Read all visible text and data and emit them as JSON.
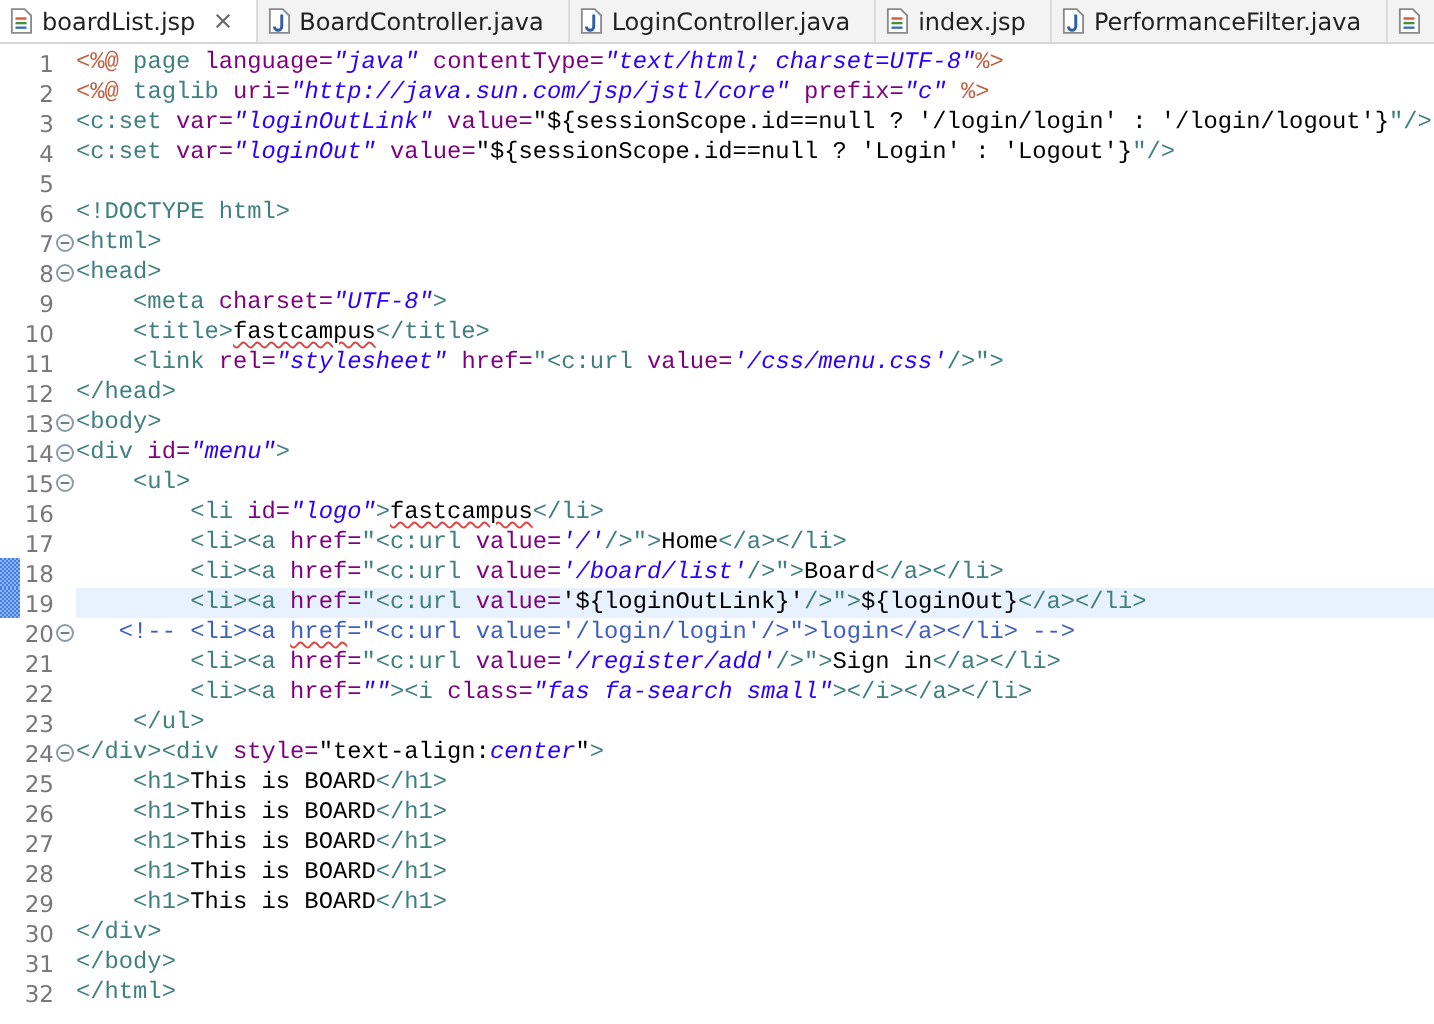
{
  "tabs": [
    {
      "label": "boardList.jsp",
      "kind": "jsp",
      "selected": true
    },
    {
      "label": "BoardController.java",
      "kind": "java",
      "selected": false
    },
    {
      "label": "LoginController.java",
      "kind": "java",
      "selected": false
    },
    {
      "label": "index.jsp",
      "kind": "jsp",
      "selected": false
    },
    {
      "label": "PerformanceFilter.java",
      "kind": "java",
      "selected": false
    },
    {
      "kind": "jsp",
      "selected": false
    }
  ],
  "editor": {
    "lines": [
      {
        "number": "1",
        "fold": false,
        "current": false,
        "marked": false,
        "tokens": [
          {
            "kind": "dir",
            "text": "<%@"
          },
          {
            "kind": "tag",
            "text": " page"
          },
          {
            "kind": "attr",
            "text": " language="
          },
          {
            "kind": "str",
            "text": "\"java\""
          },
          {
            "kind": "attr",
            "text": " contentType="
          },
          {
            "kind": "str",
            "text": "\"text/html; charset=UTF-8\""
          },
          {
            "kind": "dir",
            "text": "%>"
          }
        ]
      },
      {
        "number": "2",
        "fold": false,
        "current": false,
        "marked": false,
        "tokens": [
          {
            "kind": "dir",
            "text": "<%@"
          },
          {
            "kind": "tag",
            "text": " taglib"
          },
          {
            "kind": "attr",
            "text": " uri="
          },
          {
            "kind": "str",
            "text": "\"http://java.sun.com/jsp/jstl/core\""
          },
          {
            "kind": "attr",
            "text": " prefix="
          },
          {
            "kind": "str",
            "text": "\"c\""
          },
          {
            "kind": "dir",
            "text": " %>"
          }
        ]
      },
      {
        "number": "3",
        "fold": false,
        "current": false,
        "marked": false,
        "tokens": [
          {
            "kind": "tag",
            "text": "<c:set"
          },
          {
            "kind": "attr",
            "text": " var="
          },
          {
            "kind": "str",
            "text": "\"loginOutLink\""
          },
          {
            "kind": "attr",
            "text": " value="
          },
          {
            "kind": "text",
            "text": "\"${sessionScope.id==null ? '/login/login' : '/login/logout'}"
          },
          {
            "kind": "tag",
            "text": "\"/>"
          }
        ]
      },
      {
        "number": "4",
        "fold": false,
        "current": false,
        "marked": false,
        "tokens": [
          {
            "kind": "tag",
            "text": "<c:set"
          },
          {
            "kind": "attr",
            "text": " var="
          },
          {
            "kind": "str",
            "text": "\"loginOut\""
          },
          {
            "kind": "attr",
            "text": " value="
          },
          {
            "kind": "text",
            "text": "\"${sessionScope.id==null ? 'Login' : 'Logout'}"
          },
          {
            "kind": "tag",
            "text": "\"/>"
          }
        ]
      },
      {
        "number": "5",
        "fold": false,
        "current": false,
        "marked": false
      },
      {
        "number": "6",
        "fold": false,
        "current": false,
        "marked": false,
        "tokens": [
          {
            "kind": "tag",
            "text": "<!DOCTYPE html>"
          }
        ]
      },
      {
        "number": "7",
        "fold": true,
        "current": false,
        "marked": false,
        "tokens": [
          {
            "kind": "tag",
            "text": "<html>"
          }
        ]
      },
      {
        "number": "8",
        "fold": true,
        "current": false,
        "marked": false,
        "tokens": [
          {
            "kind": "tag",
            "text": "<head>"
          }
        ]
      },
      {
        "number": "9",
        "fold": false,
        "current": false,
        "marked": false,
        "tokens": [
          {
            "kind": "tag",
            "text": "    <meta"
          },
          {
            "kind": "attr",
            "text": " charset="
          },
          {
            "kind": "str",
            "text": "\"UTF-8\""
          },
          {
            "kind": "tag",
            "text": ">"
          }
        ]
      },
      {
        "number": "10",
        "fold": false,
        "current": false,
        "marked": false,
        "tokens": [
          {
            "kind": "tag",
            "text": "    <title>"
          },
          {
            "kind": "text",
            "text": "fastcampus",
            "squiggle": true
          },
          {
            "kind": "tag",
            "text": "</title>"
          }
        ]
      },
      {
        "number": "11",
        "fold": false,
        "current": false,
        "marked": false,
        "tokens": [
          {
            "kind": "tag",
            "text": "    <link"
          },
          {
            "kind": "attr",
            "text": " rel="
          },
          {
            "kind": "str",
            "text": "\"stylesheet\""
          },
          {
            "kind": "attr",
            "text": " href="
          },
          {
            "kind": "tag",
            "text": "\"<c:url"
          },
          {
            "kind": "attr",
            "text": " value="
          },
          {
            "kind": "str",
            "text": "'/css/menu.css'"
          },
          {
            "kind": "tag",
            "text": "/>\">"
          }
        ]
      },
      {
        "number": "12",
        "fold": false,
        "current": false,
        "marked": false,
        "tokens": [
          {
            "kind": "tag",
            "text": "</head>"
          }
        ]
      },
      {
        "number": "13",
        "fold": true,
        "current": false,
        "marked": false,
        "tokens": [
          {
            "kind": "tag",
            "text": "<body>"
          }
        ]
      },
      {
        "number": "14",
        "fold": true,
        "current": false,
        "marked": false,
        "tokens": [
          {
            "kind": "tag",
            "text": "<div"
          },
          {
            "kind": "attr",
            "text": " id="
          },
          {
            "kind": "str",
            "text": "\"menu\""
          },
          {
            "kind": "tag",
            "text": ">"
          }
        ]
      },
      {
        "number": "15",
        "fold": true,
        "current": false,
        "marked": false,
        "tokens": [
          {
            "kind": "tag",
            "text": "    <ul>"
          }
        ]
      },
      {
        "number": "16",
        "fold": false,
        "current": false,
        "marked": false,
        "tokens": [
          {
            "kind": "tag",
            "text": "        <li"
          },
          {
            "kind": "attr",
            "text": " id="
          },
          {
            "kind": "str",
            "text": "\"logo\""
          },
          {
            "kind": "tag",
            "text": ">"
          },
          {
            "kind": "text",
            "text": "fastcampus",
            "squiggle": true
          },
          {
            "kind": "tag",
            "text": "</li>"
          }
        ]
      },
      {
        "number": "17",
        "fold": false,
        "current": false,
        "marked": false,
        "tokens": [
          {
            "kind": "tag",
            "text": "        <li><a"
          },
          {
            "kind": "attr",
            "text": " href="
          },
          {
            "kind": "tag",
            "text": "\"<c:url"
          },
          {
            "kind": "attr",
            "text": " value="
          },
          {
            "kind": "str",
            "text": "'/'"
          },
          {
            "kind": "tag",
            "text": "/>\">"
          },
          {
            "kind": "text",
            "text": "Home"
          },
          {
            "kind": "tag",
            "text": "</a></li>"
          }
        ]
      },
      {
        "number": "18",
        "fold": false,
        "current": false,
        "marked": true,
        "tokens": [
          {
            "kind": "tag",
            "text": "        <li><a"
          },
          {
            "kind": "attr",
            "text": " href="
          },
          {
            "kind": "tag",
            "text": "\"<c:url"
          },
          {
            "kind": "attr",
            "text": " value="
          },
          {
            "kind": "str",
            "text": "'/board/list'"
          },
          {
            "kind": "tag",
            "text": "/>\">"
          },
          {
            "kind": "text",
            "text": "Board"
          },
          {
            "kind": "tag",
            "text": "</a></li>"
          }
        ]
      },
      {
        "number": "19",
        "fold": false,
        "current": true,
        "marked": true,
        "tokens": [
          {
            "kind": "tag",
            "text": "        <li><a"
          },
          {
            "kind": "attr",
            "text": " href="
          },
          {
            "kind": "tag",
            "text": "\"<c:url"
          },
          {
            "kind": "attr",
            "text": " value="
          },
          {
            "kind": "text",
            "text": "'${loginOutLink}'"
          },
          {
            "kind": "tag",
            "text": "/>\">"
          },
          {
            "kind": "text",
            "text": "${loginOut}"
          },
          {
            "kind": "tag",
            "text": "</a></li>"
          }
        ]
      },
      {
        "number": "20",
        "fold": true,
        "current": false,
        "marked": false,
        "tokens": [
          {
            "kind": "comment",
            "text": "   <!-- <li><a "
          },
          {
            "kind": "comment",
            "text": "href",
            "squiggle": true
          },
          {
            "kind": "comment",
            "text": "=\"<c:url value='/login/login'/>\">login</a></li> -->"
          }
        ]
      },
      {
        "number": "21",
        "fold": false,
        "current": false,
        "marked": false,
        "tokens": [
          {
            "kind": "tag",
            "text": "        <li><a"
          },
          {
            "kind": "attr",
            "text": " href="
          },
          {
            "kind": "tag",
            "text": "\"<c:url"
          },
          {
            "kind": "attr",
            "text": " value="
          },
          {
            "kind": "str",
            "text": "'/register/add'"
          },
          {
            "kind": "tag",
            "text": "/>\">"
          },
          {
            "kind": "text",
            "text": "Sign in"
          },
          {
            "kind": "tag",
            "text": "</a></li>"
          }
        ]
      },
      {
        "number": "22",
        "fold": false,
        "current": false,
        "marked": false,
        "tokens": [
          {
            "kind": "tag",
            "text": "        <li><a"
          },
          {
            "kind": "attr",
            "text": " href="
          },
          {
            "kind": "str",
            "text": "\"\""
          },
          {
            "kind": "tag",
            "text": "><i"
          },
          {
            "kind": "attr",
            "text": " class="
          },
          {
            "kind": "str",
            "text": "\"fas fa-search small\""
          },
          {
            "kind": "tag",
            "text": "></i></a></li>"
          }
        ]
      },
      {
        "number": "23",
        "fold": false,
        "current": false,
        "marked": false,
        "tokens": [
          {
            "kind": "tag",
            "text": "    </ul>"
          }
        ]
      },
      {
        "number": "24",
        "fold": true,
        "current": false,
        "marked": false,
        "tokens": [
          {
            "kind": "tag",
            "text": "</div><div"
          },
          {
            "kind": "attr",
            "text": " style="
          },
          {
            "kind": "text",
            "text": "\"text-align:"
          },
          {
            "kind": "str",
            "text": "center"
          },
          {
            "kind": "text",
            "text": "\""
          },
          {
            "kind": "tag",
            "text": ">"
          }
        ]
      },
      {
        "number": "25",
        "fold": false,
        "current": false,
        "marked": false,
        "tokens": [
          {
            "kind": "tag",
            "text": "    <h1>"
          },
          {
            "kind": "text",
            "text": "This is BOARD"
          },
          {
            "kind": "tag",
            "text": "</h1>"
          }
        ]
      },
      {
        "number": "26",
        "fold": false,
        "current": false,
        "marked": false,
        "tokens": [
          {
            "kind": "tag",
            "text": "    <h1>"
          },
          {
            "kind": "text",
            "text": "This is BOARD"
          },
          {
            "kind": "tag",
            "text": "</h1>"
          }
        ]
      },
      {
        "number": "27",
        "fold": false,
        "current": false,
        "marked": false,
        "tokens": [
          {
            "kind": "tag",
            "text": "    <h1>"
          },
          {
            "kind": "text",
            "text": "This is BOARD"
          },
          {
            "kind": "tag",
            "text": "</h1>"
          }
        ]
      },
      {
        "number": "28",
        "fold": false,
        "current": false,
        "marked": false,
        "tokens": [
          {
            "kind": "tag",
            "text": "    <h1>"
          },
          {
            "kind": "text",
            "text": "This is BOARD"
          },
          {
            "kind": "tag",
            "text": "</h1>"
          }
        ]
      },
      {
        "number": "29",
        "fold": false,
        "current": false,
        "marked": false,
        "tokens": [
          {
            "kind": "tag",
            "text": "    <h1>"
          },
          {
            "kind": "text",
            "text": "This is BOARD"
          },
          {
            "kind": "tag",
            "text": "</h1>"
          }
        ]
      },
      {
        "number": "30",
        "fold": false,
        "current": false,
        "marked": false,
        "tokens": [
          {
            "kind": "tag",
            "text": "</div>"
          }
        ]
      },
      {
        "number": "31",
        "fold": false,
        "current": false,
        "marked": false,
        "tokens": [
          {
            "kind": "tag",
            "text": "</body>"
          }
        ]
      },
      {
        "number": "32",
        "fold": false,
        "current": false,
        "marked": false,
        "tokens": [
          {
            "kind": "tag",
            "text": "</html>"
          }
        ]
      }
    ]
  }
}
